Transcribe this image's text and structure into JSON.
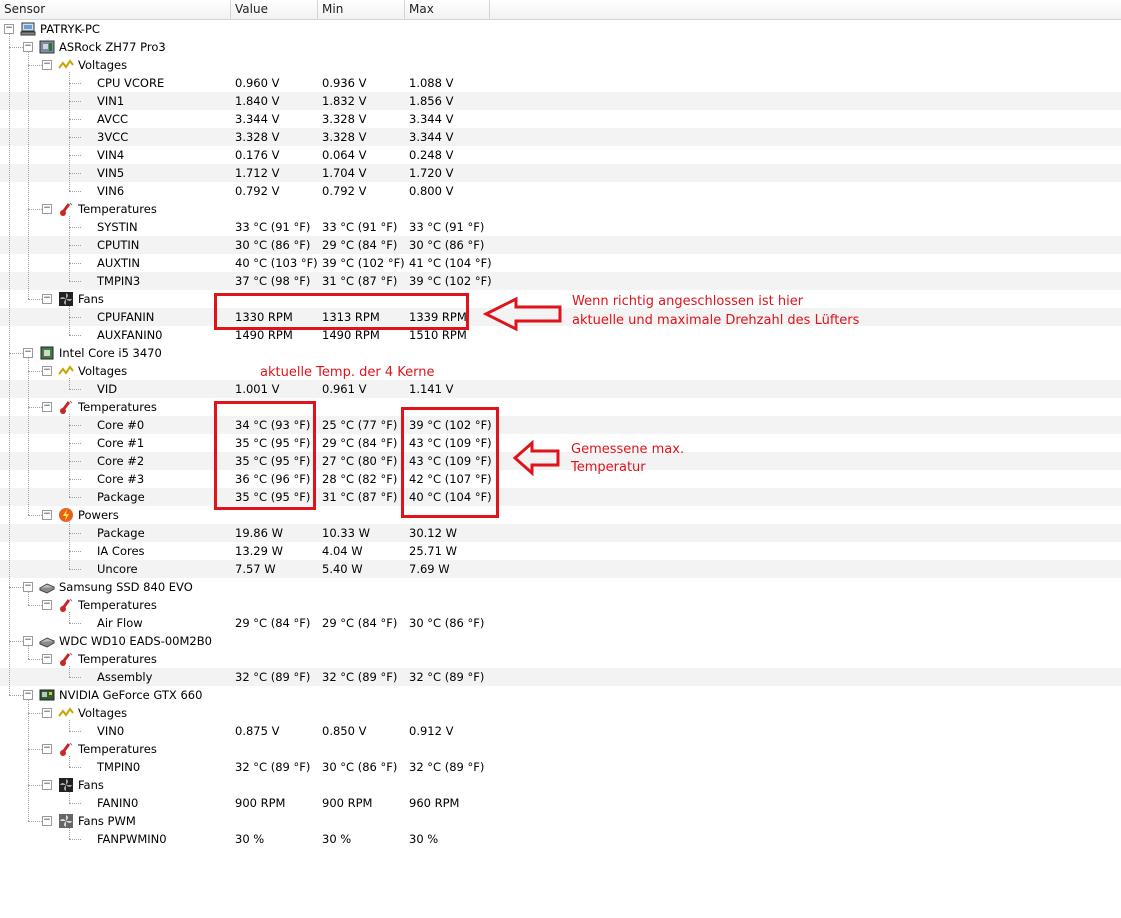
{
  "columns": {
    "sensor": "Sensor",
    "value": "Value",
    "min": "Min",
    "max": "Max"
  },
  "tree": [
    {
      "level": 0,
      "type": "computer",
      "label": "PATRYK-PC"
    },
    {
      "level": 1,
      "type": "board",
      "label": "ASRock ZH77 Pro3"
    },
    {
      "level": 2,
      "type": "voltage",
      "label": "Voltages"
    },
    {
      "level": 3,
      "label": "CPU VCORE",
      "value": "0.960 V",
      "min": "0.936 V",
      "max": "1.088 V"
    },
    {
      "level": 3,
      "label": "VIN1",
      "value": "1.840 V",
      "min": "1.832 V",
      "max": "1.856 V"
    },
    {
      "level": 3,
      "label": "AVCC",
      "value": "3.344 V",
      "min": "3.328 V",
      "max": "3.344 V"
    },
    {
      "level": 3,
      "label": "3VCC",
      "value": "3.328 V",
      "min": "3.328 V",
      "max": "3.344 V"
    },
    {
      "level": 3,
      "label": "VIN4",
      "value": "0.176 V",
      "min": "0.064 V",
      "max": "0.248 V"
    },
    {
      "level": 3,
      "label": "VIN5",
      "value": "1.712 V",
      "min": "1.704 V",
      "max": "1.720 V"
    },
    {
      "level": 3,
      "label": "VIN6",
      "value": "0.792 V",
      "min": "0.792 V",
      "max": "0.800 V"
    },
    {
      "level": 2,
      "type": "temperature",
      "label": "Temperatures"
    },
    {
      "level": 3,
      "label": "SYSTIN",
      "value": "33 °C  (91 °F)",
      "min": "33 °C  (91 °F)",
      "max": "33 °C  (91 °F)"
    },
    {
      "level": 3,
      "label": "CPUTIN",
      "value": "30 °C  (86 °F)",
      "min": "29 °C  (84 °F)",
      "max": "30 °C  (86 °F)"
    },
    {
      "level": 3,
      "label": "AUXTIN",
      "value": "40 °C  (103 °F)",
      "min": "39 °C  (102 °F)",
      "max": "41 °C  (104 °F)"
    },
    {
      "level": 3,
      "label": "TMPIN3",
      "value": "37 °C  (98 °F)",
      "min": "31 °C  (87 °F)",
      "max": "39 °C  (102 °F)"
    },
    {
      "level": 2,
      "type": "fan",
      "label": "Fans"
    },
    {
      "level": 3,
      "label": "CPUFANIN",
      "value": "1330 RPM",
      "min": "1313 RPM",
      "max": "1339 RPM"
    },
    {
      "level": 3,
      "label": "AUXFANIN0",
      "value": "1490 RPM",
      "min": "1490 RPM",
      "max": "1510 RPM"
    },
    {
      "level": 1,
      "type": "cpu",
      "label": "Intel Core i5 3470"
    },
    {
      "level": 2,
      "type": "voltage",
      "label": "Voltages"
    },
    {
      "level": 3,
      "label": "VID",
      "value": "1.001 V",
      "min": "0.961 V",
      "max": "1.141 V"
    },
    {
      "level": 2,
      "type": "temperature",
      "label": "Temperatures"
    },
    {
      "level": 3,
      "label": "Core #0",
      "value": "34 °C  (93 °F)",
      "min": "25 °C  (77 °F)",
      "max": "39 °C  (102 °F)"
    },
    {
      "level": 3,
      "label": "Core #1",
      "value": "35 °C  (95 °F)",
      "min": "29 °C  (84 °F)",
      "max": "43 °C  (109 °F)"
    },
    {
      "level": 3,
      "label": "Core #2",
      "value": "35 °C  (95 °F)",
      "min": "27 °C  (80 °F)",
      "max": "43 °C  (109 °F)"
    },
    {
      "level": 3,
      "label": "Core #3",
      "value": "36 °C  (96 °F)",
      "min": "28 °C  (82 °F)",
      "max": "42 °C  (107 °F)"
    },
    {
      "level": 3,
      "label": "Package",
      "value": "35 °C  (95 °F)",
      "min": "31 °C  (87 °F)",
      "max": "40 °C  (104 °F)"
    },
    {
      "level": 2,
      "type": "power",
      "label": "Powers"
    },
    {
      "level": 3,
      "label": "Package",
      "value": "19.86 W",
      "min": "10.33 W",
      "max": "30.12 W"
    },
    {
      "level": 3,
      "label": "IA Cores",
      "value": "13.29 W",
      "min": "4.04 W",
      "max": "25.71 W"
    },
    {
      "level": 3,
      "label": "Uncore",
      "value": "7.57 W",
      "min": "5.40 W",
      "max": "7.69 W"
    },
    {
      "level": 1,
      "type": "disk",
      "label": "Samsung SSD 840 EVO"
    },
    {
      "level": 2,
      "type": "temperature",
      "label": "Temperatures"
    },
    {
      "level": 3,
      "label": "Air Flow",
      "value": "29 °C  (84 °F)",
      "min": "29 °C  (84 °F)",
      "max": "30 °C  (86 °F)"
    },
    {
      "level": 1,
      "type": "disk",
      "label": "WDC WD10 EADS-00M2B0"
    },
    {
      "level": 2,
      "type": "temperature",
      "label": "Temperatures"
    },
    {
      "level": 3,
      "label": "Assembly",
      "value": "32 °C  (89 °F)",
      "min": "32 °C  (89 °F)",
      "max": "32 °C  (89 °F)"
    },
    {
      "level": 1,
      "type": "gpu",
      "label": "NVIDIA GeForce GTX 660"
    },
    {
      "level": 2,
      "type": "voltage",
      "label": "Voltages"
    },
    {
      "level": 3,
      "label": "VIN0",
      "value": "0.875 V",
      "min": "0.850 V",
      "max": "0.912 V"
    },
    {
      "level": 2,
      "type": "temperature",
      "label": "Temperatures"
    },
    {
      "level": 3,
      "label": "TMPIN0",
      "value": "32 °C  (89 °F)",
      "min": "30 °C  (86 °F)",
      "max": "32 °C  (89 °F)"
    },
    {
      "level": 2,
      "type": "fan",
      "label": "Fans"
    },
    {
      "level": 3,
      "label": "FANIN0",
      "value": "900 RPM",
      "min": "900 RPM",
      "max": "960 RPM"
    },
    {
      "level": 2,
      "type": "fanpwm",
      "label": "Fans PWM"
    },
    {
      "level": 3,
      "label": "FANPWMIN0",
      "value": "30 %",
      "min": "30 %",
      "max": "30 %"
    }
  ],
  "annotations": {
    "fan_note_line1": "Wenn richtig angeschlossen ist hier",
    "fan_note_line2": "aktuelle und maximale Drehzahl des Lüfters",
    "cores_note": "aktuelle Temp. der 4 Kerne",
    "max_note_line1": "Gemessene max.",
    "max_note_line2": "Temperatur",
    "color": "#e0131b"
  }
}
